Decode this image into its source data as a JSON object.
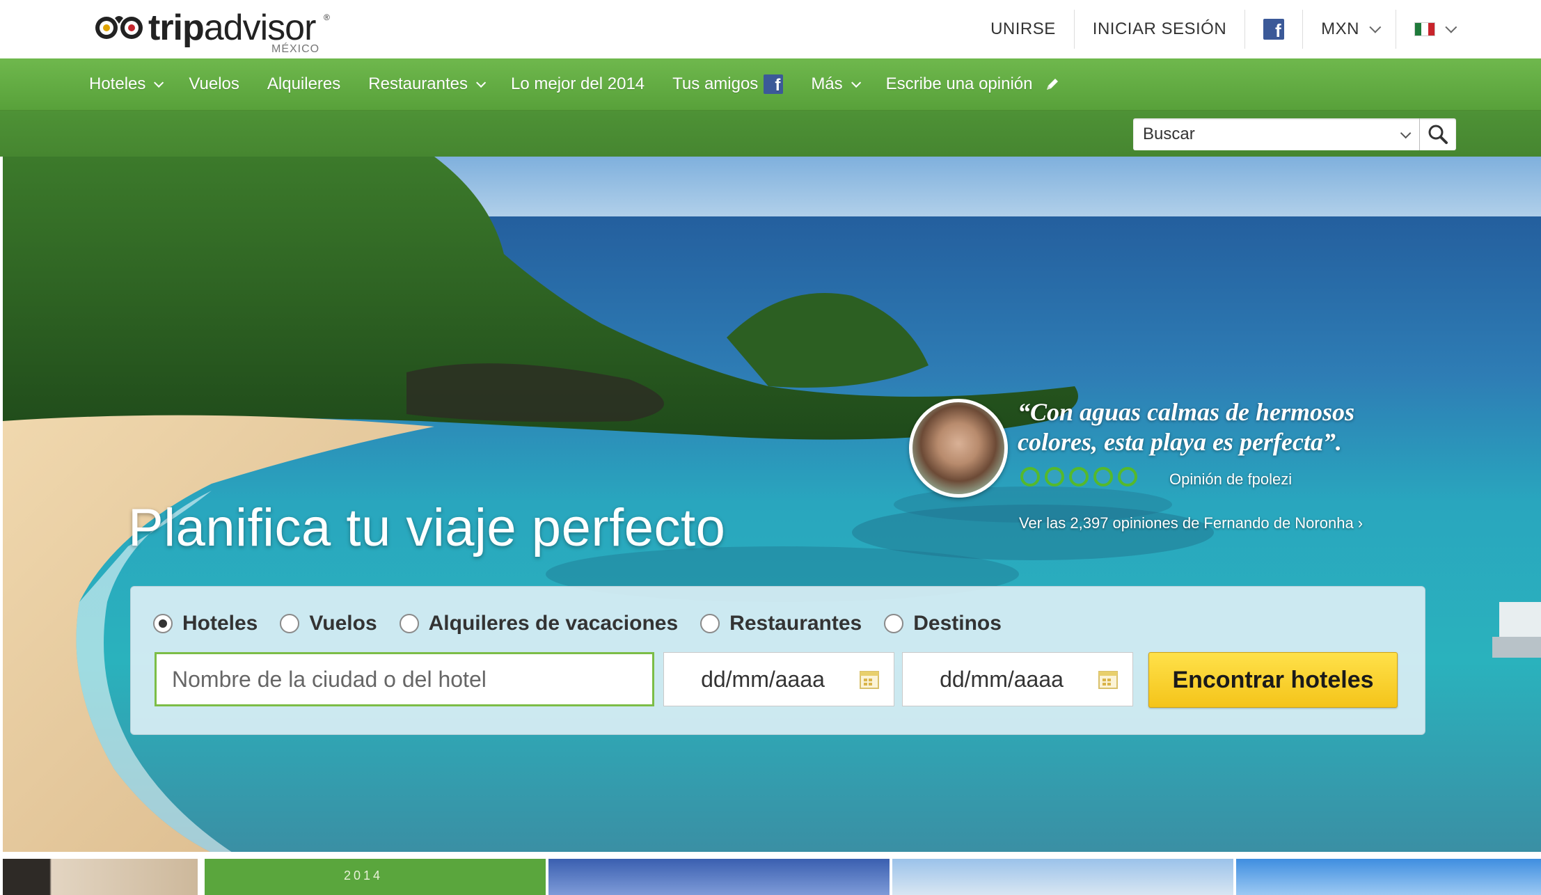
{
  "header": {
    "logo_text_trip": "trip",
    "logo_text_advisor": "advisor",
    "logo_registered": "®",
    "logo_country": "MÉXICO",
    "links": {
      "join": "UNIRSE",
      "sign_in": "INICIAR SESIÓN",
      "facebook_glyph": "f",
      "currency": "MXN"
    }
  },
  "nav": {
    "items": [
      {
        "label": "Hoteles"
      },
      {
        "label": "Vuelos"
      },
      {
        "label": "Alquileres"
      },
      {
        "label": "Restaurantes"
      },
      {
        "label": "Lo mejor del 2014"
      },
      {
        "label": "Tus amigos"
      },
      {
        "label": "Más"
      },
      {
        "label": "Escribe una opinión"
      }
    ]
  },
  "search": {
    "placeholder": "Buscar"
  },
  "hero": {
    "headline": "Planifica tu viaje perfecto",
    "quote": "“Con aguas calmas de hermosos colores, esta playa es perfecta”.",
    "rating_bubbles": 5,
    "review_by": "Opinión de fpolezi",
    "see_reviews": "Ver las 2,397 opiniones de Fernando de Noronha  ›"
  },
  "booking": {
    "options": [
      {
        "label": "Hoteles",
        "selected": true
      },
      {
        "label": "Vuelos",
        "selected": false
      },
      {
        "label": "Alquileres de vacaciones",
        "selected": false
      },
      {
        "label": "Restaurantes",
        "selected": false
      },
      {
        "label": "Destinos",
        "selected": false
      }
    ],
    "city_placeholder": "Nombre de la ciudad o del hotel",
    "checkin_placeholder": "dd/mm/aaaa",
    "checkout_placeholder": "dd/mm/aaaa",
    "submit_label": "Encontrar hoteles"
  },
  "tiles": {
    "year_text": "2014"
  },
  "colors": {
    "nav_green": "#5fa83f",
    "subnav_green": "#4a8c33",
    "button_yellow": "#f8cf2a",
    "bubble_green": "#55b92c",
    "facebook_blue": "#3b5998"
  },
  "icons": [
    "owl-logo-icon",
    "facebook-icon",
    "chevron-down-icon",
    "mexico-flag-icon",
    "pencil-icon",
    "search-icon",
    "calendar-icon",
    "radio-icon"
  ]
}
